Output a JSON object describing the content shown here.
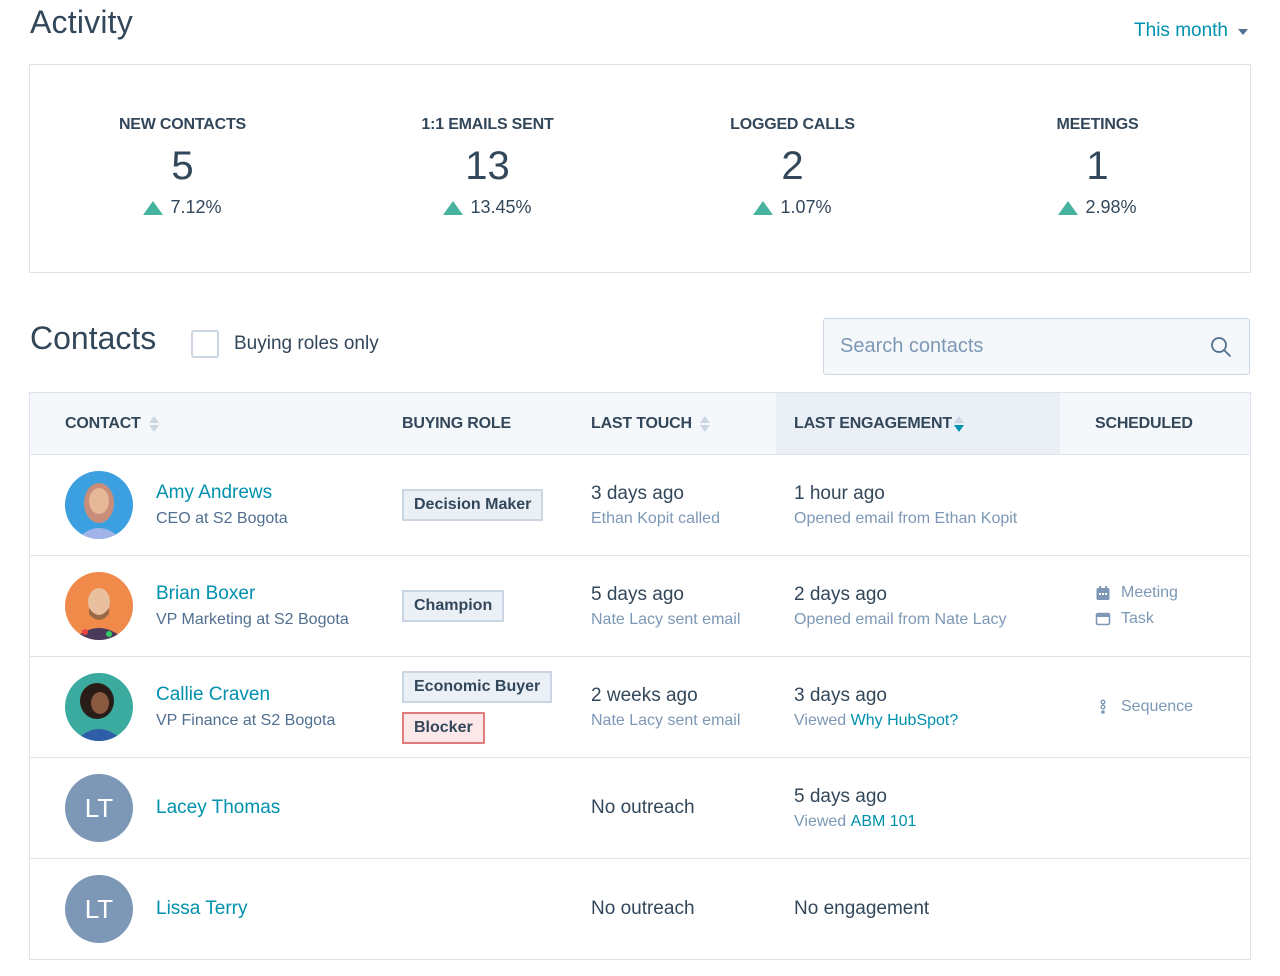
{
  "activity": {
    "title": "Activity",
    "period": "This month",
    "stats": [
      {
        "label": "NEW CONTACTS",
        "value": "5",
        "change": "7.12%",
        "trend": "up"
      },
      {
        "label": "1:1 EMAILS SENT",
        "value": "13",
        "change": "13.45%",
        "trend": "up"
      },
      {
        "label": "LOGGED CALLS",
        "value": "2",
        "change": "1.07%",
        "trend": "up"
      },
      {
        "label": "MEETINGS",
        "value": "1",
        "change": "2.98%",
        "trend": "up"
      }
    ],
    "trend_color": "#45b39d"
  },
  "contacts": {
    "title": "Contacts",
    "filter_label": "Buying roles only",
    "filter_checked": false,
    "search_placeholder": "Search contacts",
    "columns": {
      "contact": "CONTACT",
      "buying_role": "BUYING ROLE",
      "last_touch": "LAST TOUCH",
      "last_engagement": "LAST ENGAGEMENT",
      "scheduled": "SCHEDULED"
    },
    "sorted_by": "LAST ENGAGEMENT",
    "sort_direction": "descending",
    "rows": [
      {
        "name": "Amy Andrews",
        "title": "CEO at S2 Bogota",
        "avatar": "photo",
        "roles": [
          "Decision Maker"
        ],
        "last_touch": {
          "when": "3 days ago",
          "detail": "Ethan Kopit called"
        },
        "last_engagement": {
          "when": "1 hour ago",
          "detail_prefix": "Opened email from Ethan Kopit",
          "detail_link": ""
        },
        "scheduled": []
      },
      {
        "name": "Brian Boxer",
        "title": "VP Marketing at S2 Bogota",
        "avatar": "photo",
        "roles": [
          "Champion"
        ],
        "last_touch": {
          "when": "5 days ago",
          "detail": "Nate Lacy sent email"
        },
        "last_engagement": {
          "when": "2 days ago",
          "detail_prefix": "Opened email from Nate Lacy",
          "detail_link": ""
        },
        "scheduled": [
          {
            "icon": "calendar-icon",
            "label": "Meeting"
          },
          {
            "icon": "task-icon",
            "label": "Task"
          }
        ]
      },
      {
        "name": "Callie Craven",
        "title": "VP Finance at S2 Bogota",
        "avatar": "photo",
        "roles": [
          "Economic Buyer",
          "Blocker"
        ],
        "last_touch": {
          "when": "2 weeks ago",
          "detail": "Nate Lacy sent email"
        },
        "last_engagement": {
          "when": "3 days ago",
          "detail_prefix": "Viewed ",
          "detail_link": "Why HubSpot?"
        },
        "scheduled": [
          {
            "icon": "sequence-icon",
            "label": "Sequence"
          }
        ]
      },
      {
        "name": "Lacey Thomas",
        "title": "",
        "avatar": "initials",
        "initials": "LT",
        "roles": [],
        "last_touch": {
          "when": "No outreach",
          "detail": ""
        },
        "last_engagement": {
          "when": "5 days ago",
          "detail_prefix": "Viewed ",
          "detail_link": "ABM 101"
        },
        "scheduled": []
      },
      {
        "name": "Lissa Terry",
        "title": "",
        "avatar": "initials",
        "initials": "LT",
        "roles": [],
        "last_touch": {
          "when": "No outreach",
          "detail": ""
        },
        "last_engagement": {
          "when": "No engagement",
          "detail_prefix": "",
          "detail_link": ""
        },
        "scheduled": []
      }
    ]
  },
  "colors": {
    "accent": "#0091ae",
    "text": "#33475b",
    "muted": "#7c98b6",
    "border": "#dfe3eb",
    "header_bg": "#f5f8fa",
    "active_header_bg": "#eaf0f6",
    "blocker_border": "#e27b7b"
  }
}
